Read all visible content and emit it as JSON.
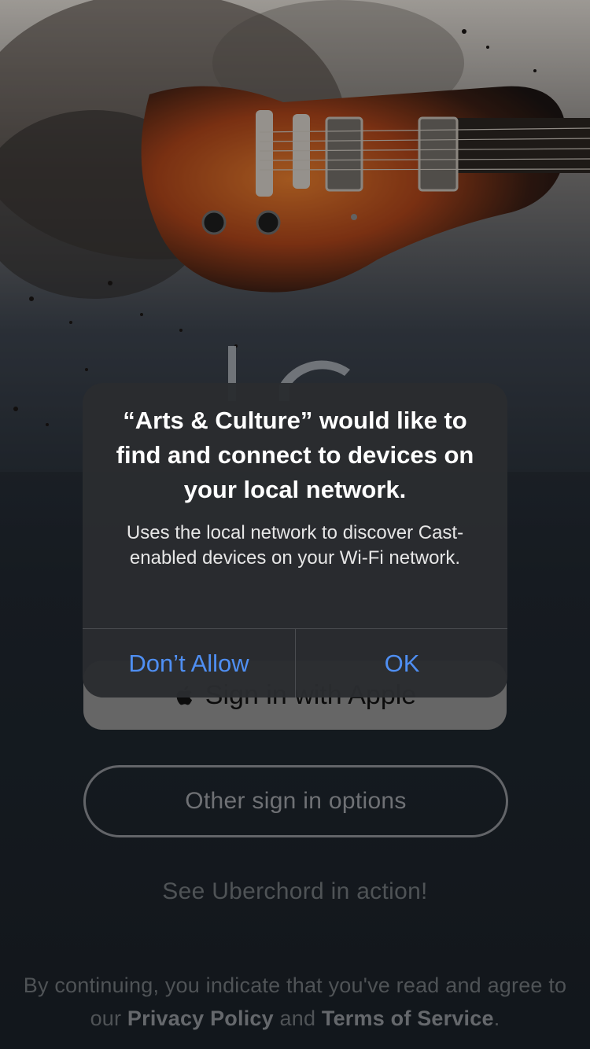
{
  "colors": {
    "alert_background": "#2a2c2f",
    "alert_button_text": "#4f8ff3",
    "screen_background": "#1b2129"
  },
  "alert": {
    "title": "“Arts & Culture” would like to find and connect to devices on your local network.",
    "message": "Uses the local network to discover Cast-enabled devices on your Wi-Fi network.",
    "deny_label": "Don’t Allow",
    "ok_label": "OK"
  },
  "login": {
    "apple_button_label": "Sign in with Apple",
    "apple_icon": "apple-logo-icon",
    "other_options_label": "Other sign in options",
    "demo_link": "See Uberchord in action!"
  },
  "legal": {
    "prefix": "By continuing, you indicate that you've read and agree  to our ",
    "privacy": "Privacy Policy",
    "and": " and ",
    "terms": "Terms of Service",
    "suffix": "."
  }
}
